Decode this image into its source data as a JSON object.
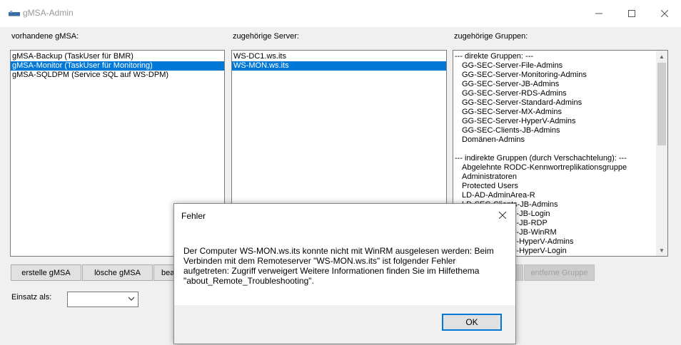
{
  "window": {
    "title": "gMSA-Admin",
    "minimize_label": "—",
    "maximize_label": "☐",
    "close_label": "✕"
  },
  "labels": {
    "gmsa": "vorhandene gMSA:",
    "server": "zugehörige Server:",
    "groups": "zugehörige Gruppen:",
    "einsatz": "Einsatz als:"
  },
  "gmsa_list": [
    "gMSA-Backup (TaskUser für BMR)",
    "gMSA-Monitor (TaskUser für Monitoring)",
    "gMSA-SQLDPM (Service SQL auf WS-DPM)"
  ],
  "server_list": [
    "WS-DC1.ws.its",
    "WS-MON.ws.its"
  ],
  "groups_list": [
    "--- direkte Gruppen: ---",
    "GG-SEC-Server-File-Admins",
    "GG-SEC-Server-Monitoring-Admins",
    "GG-SEC-Server-JB-Admins",
    "GG-SEC-Server-RDS-Admins",
    "GG-SEC-Server-Standard-Admins",
    "GG-SEC-Server-MX-Admins",
    "GG-SEC-Server-HyperV-Admins",
    "GG-SEC-Clients-JB-Admins",
    "Domänen-Admins",
    "",
    "--- indirekte Gruppen (durch Verschachtelung): ---",
    "Abgelehnte RODC-Kennwortreplikationsgruppe",
    "Administratoren",
    "Protected Users",
    "LD-AD-AdminArea-R",
    "LD-SEC-Clients-JB-Admins",
    "LD-SEC-Server-JB-Login",
    "LD-SEC-Server-JB-RDP",
    "LD-SEC-Server-JB-WinRM",
    "LD-SEC-Server-HyperV-Admins",
    "LD-SEC-Server-HyperV-Login"
  ],
  "buttons": {
    "create": "erstelle gMSA",
    "delete": "lösche gMSA",
    "edit": "bearbeite gMSA",
    "add_group": "",
    "remove_group": "entferne Gruppe"
  },
  "combo": {
    "value": ""
  },
  "dialog": {
    "title": "Fehler",
    "message": "Der Computer WS-MON.ws.its konnte nicht mit WinRM ausgelesen werden: Beim Verbinden mit dem Remoteserver \"WS-MON.ws.its\" ist folgender Fehler aufgetreten: Zugriff verweigert Weitere Informationen finden Sie im Hilfethema \"about_Remote_Troubleshooting\".",
    "ok_label": "OK"
  },
  "colors": {
    "selection": "#0078d7",
    "window_bg": "#f0f0f0"
  }
}
